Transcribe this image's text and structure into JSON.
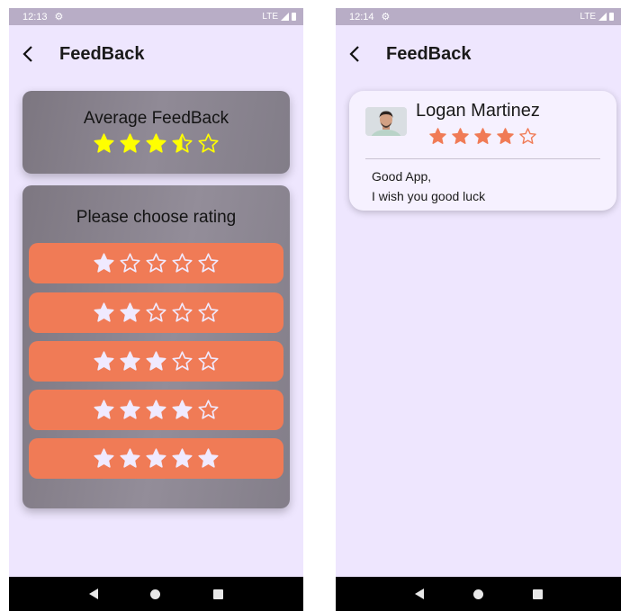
{
  "left": {
    "status": {
      "time": "12:13",
      "network": "LTE"
    },
    "title": "FeedBack",
    "average": {
      "label": "Average FeedBack",
      "rating": 3.5,
      "out_of": 5,
      "star_color": "#ffff00"
    },
    "choose": {
      "label": "Please choose rating",
      "options": [
        {
          "stars": 1
        },
        {
          "stars": 2
        },
        {
          "stars": 3
        },
        {
          "stars": 4
        },
        {
          "stars": 5
        }
      ],
      "button_color": "#f07b56",
      "star_color": "#f0eaff"
    }
  },
  "right": {
    "status": {
      "time": "12:14",
      "network": "LTE"
    },
    "title": "FeedBack",
    "review": {
      "name": "Logan Martinez",
      "rating": 4,
      "out_of": 5,
      "star_color": "#f07b56",
      "text_line1": "Good App,",
      "text_line2": "I wish you good luck"
    }
  },
  "icons": {
    "back": "back-arrow-icon",
    "settings": "gear-icon",
    "signal": "signal-icon",
    "battery": "battery-icon",
    "nav_back": "nav-back-icon",
    "nav_home": "nav-home-icon",
    "nav_recent": "nav-recent-icon"
  },
  "colors": {
    "background": "#eee6fe",
    "statusbar": "#b8adc6",
    "card_gray": "#8a8490",
    "review_card": "#f6f1ff"
  }
}
